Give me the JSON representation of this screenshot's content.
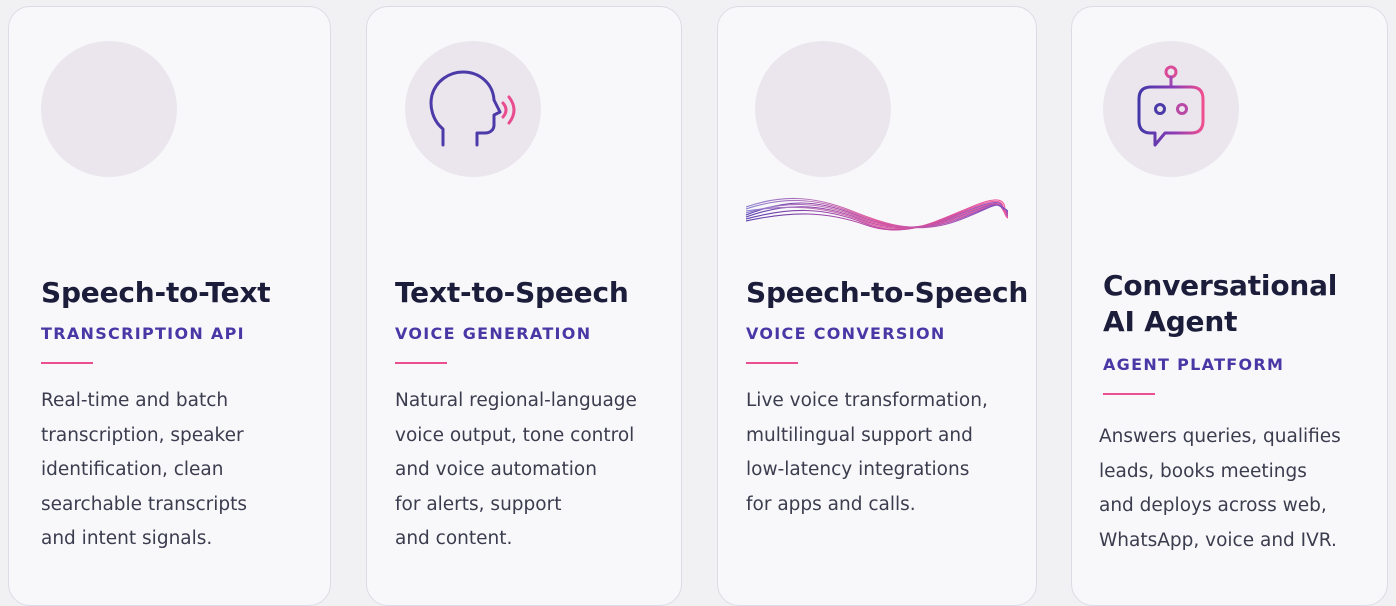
{
  "colors": {
    "accent_pink": "#ea4f90",
    "accent_purple": "#4a37a6",
    "title_navy": "#1b1d3a",
    "body_text": "#3b3c4e",
    "icon_circle": "#ebe6ee"
  },
  "cards": [
    {
      "icon": "sound-bars-icon",
      "title": "Speech-to-Text",
      "subtitle": "TRANSCRIPTION API",
      "description": [
        "Real-time and batch",
        "transcription, speaker",
        "identification, clean",
        "searchable transcripts",
        "and intent signals."
      ]
    },
    {
      "icon": "speaking-head-icon",
      "title": "Text-to-Speech",
      "subtitle": "VOICE GENERATION",
      "description": [
        "Natural regional-language",
        "voice output, tone control",
        "and voice automation",
        "for alerts, support",
        "and content."
      ]
    },
    {
      "icon": "sound-bars-icon",
      "title": "Speech-to-Speech",
      "subtitle": "VOICE CONVERSION",
      "description": [
        "Live voice transformation,",
        "multilingual support and",
        "low-latency integrations",
        "for apps and calls."
      ]
    },
    {
      "icon": "robot-chat-icon",
      "title_lines": [
        "Conversational",
        "AI Agent"
      ],
      "subtitle": "AGENT PLATFORM",
      "description": [
        "Answers queries, qualifies",
        "leads, books meetings",
        "and deploys across web,",
        "WhatsApp, voice and IVR."
      ]
    }
  ]
}
